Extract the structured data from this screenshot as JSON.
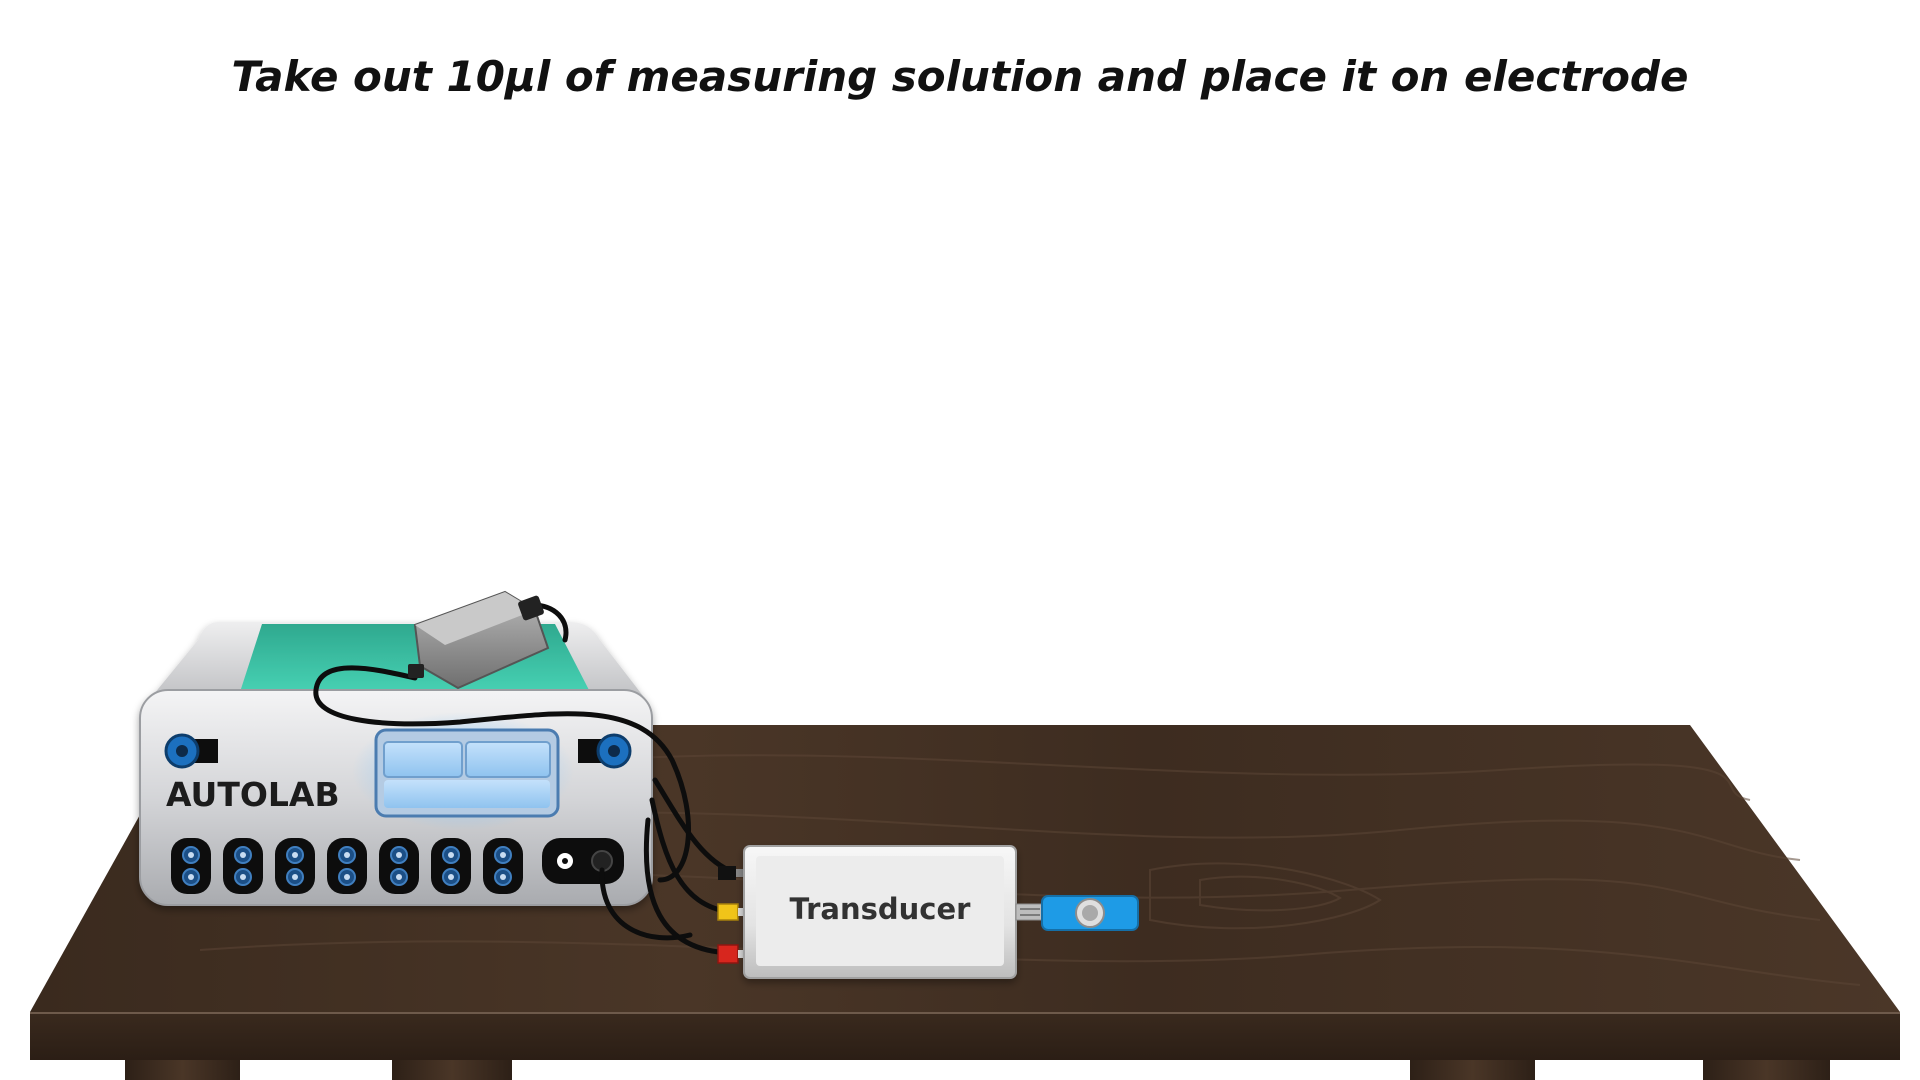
{
  "instruction": {
    "text": "Take out 10µl of measuring solution and place it on electrode"
  },
  "instrument": {
    "label": "AUTOLAB"
  },
  "transducer": {
    "label": "Transducer"
  },
  "colors": {
    "table_top": "#3b2a1f",
    "table_edge": "#2a1d14",
    "autolab_body": "#d9dadc",
    "autolab_tray": "#3cc5a8",
    "display_blue": "#a9d2f5",
    "electrode_blue": "#1e9be6",
    "cable": "#111111",
    "yellow_plug": "#f0c419",
    "red_plug": "#d7261e"
  },
  "icons": {
    "power_adapter": "power-adapter-icon",
    "electrode": "screen-printed-electrode-icon"
  }
}
